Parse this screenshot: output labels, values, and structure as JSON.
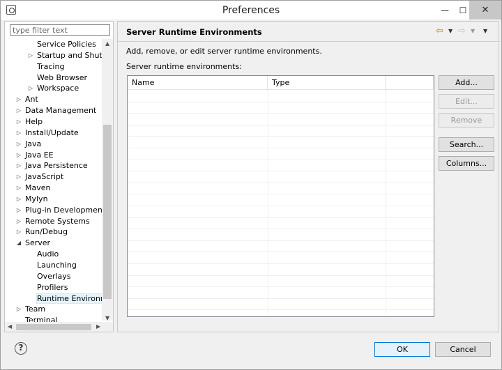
{
  "window": {
    "title": "Preferences",
    "min_glyph": "—",
    "max_glyph": "☐",
    "close_glyph": "✕"
  },
  "filter": {
    "placeholder": "type filter text"
  },
  "tree": [
    {
      "label": "Service Policies",
      "level": 2,
      "arrow": ""
    },
    {
      "label": "Startup and Shutdo",
      "level": 2,
      "arrow": "▷"
    },
    {
      "label": "Tracing",
      "level": 2,
      "arrow": ""
    },
    {
      "label": "Web Browser",
      "level": 2,
      "arrow": ""
    },
    {
      "label": "Workspace",
      "level": 2,
      "arrow": "▷"
    },
    {
      "label": "Ant",
      "level": 1,
      "arrow": "▷"
    },
    {
      "label": "Data Management",
      "level": 1,
      "arrow": "▷"
    },
    {
      "label": "Help",
      "level": 1,
      "arrow": "▷"
    },
    {
      "label": "Install/Update",
      "level": 1,
      "arrow": "▷"
    },
    {
      "label": "Java",
      "level": 1,
      "arrow": "▷"
    },
    {
      "label": "Java EE",
      "level": 1,
      "arrow": "▷"
    },
    {
      "label": "Java Persistence",
      "level": 1,
      "arrow": "▷"
    },
    {
      "label": "JavaScript",
      "level": 1,
      "arrow": "▷"
    },
    {
      "label": "Maven",
      "level": 1,
      "arrow": "▷"
    },
    {
      "label": "Mylyn",
      "level": 1,
      "arrow": "▷"
    },
    {
      "label": "Plug-in Development",
      "level": 1,
      "arrow": "▷"
    },
    {
      "label": "Remote Systems",
      "level": 1,
      "arrow": "▷"
    },
    {
      "label": "Run/Debug",
      "level": 1,
      "arrow": "▷"
    },
    {
      "label": "Server",
      "level": 1,
      "arrow": "◢"
    },
    {
      "label": "Audio",
      "level": 2,
      "arrow": ""
    },
    {
      "label": "Launching",
      "level": 2,
      "arrow": ""
    },
    {
      "label": "Overlays",
      "level": 2,
      "arrow": ""
    },
    {
      "label": "Profilers",
      "level": 2,
      "arrow": ""
    },
    {
      "label": "Runtime Environme",
      "level": 2,
      "arrow": "",
      "selected": true
    },
    {
      "label": "Team",
      "level": 1,
      "arrow": "▷"
    },
    {
      "label": "Terminal",
      "level": 1,
      "arrow": ""
    }
  ],
  "page": {
    "title": "Server Runtime Environments",
    "description": "Add, remove, or edit server runtime environments.",
    "list_label": "Server runtime environments:",
    "columns": [
      "Name",
      "Type"
    ]
  },
  "buttons": {
    "add": "Add...",
    "edit": "Edit...",
    "remove": "Remove",
    "search": "Search...",
    "columns": "Columns..."
  },
  "footer": {
    "help_glyph": "?",
    "ok": "OK",
    "cancel": "Cancel"
  },
  "icons": {
    "back": "back-arrow-icon",
    "forward": "forward-arrow-icon",
    "menu": "view-menu-icon"
  },
  "colors": {
    "selection": "#e5f3fb",
    "default_button_border": "#0078d7",
    "nav_arrow": "#b88a00"
  }
}
